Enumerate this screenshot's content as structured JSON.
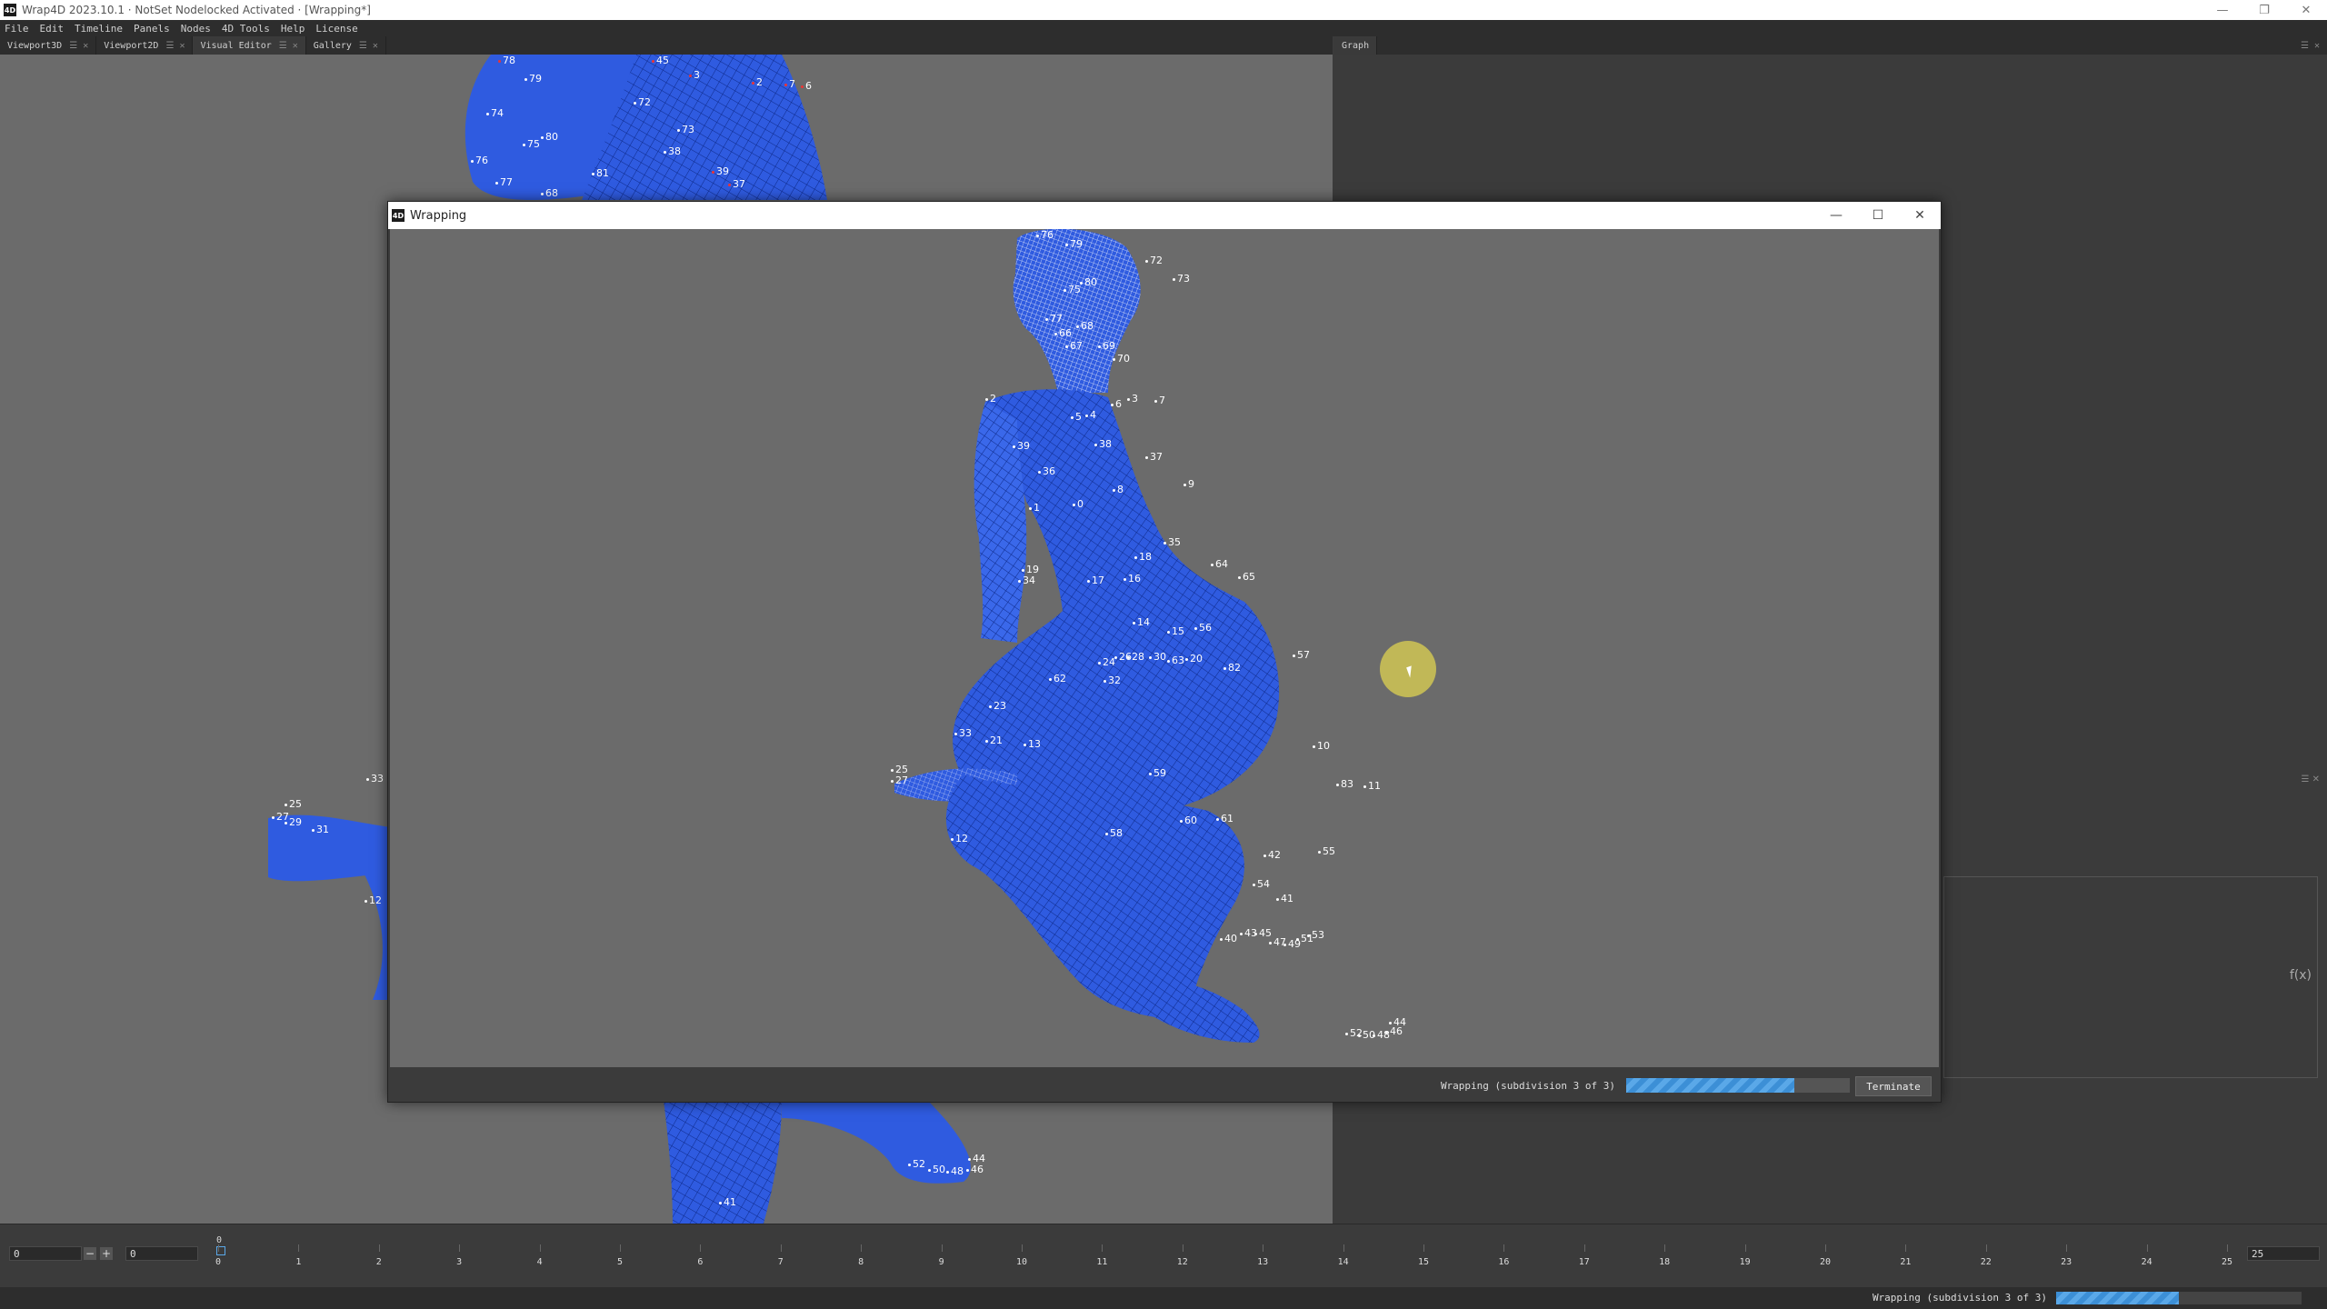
{
  "titlebar": {
    "icon": "4D",
    "title": "Wrap4D 2023.10.1 · NotSet Nodelocked Activated · [Wrapping*]",
    "controls": [
      "—",
      "❐",
      "✕"
    ]
  },
  "menu": [
    "File",
    "Edit",
    "Timeline",
    "Panels",
    "Nodes",
    "4D Tools",
    "Help",
    "License"
  ],
  "tabs_left": [
    {
      "label": "Viewport3D"
    },
    {
      "label": "Viewport2D"
    },
    {
      "label": "Visual Editor"
    },
    {
      "label": "Gallery"
    }
  ],
  "tabs_right": [
    {
      "label": "Graph"
    }
  ],
  "right_lower": {
    "fx": "f(x)"
  },
  "dialog": {
    "title": "Wrapping",
    "controls": [
      "—",
      "☐",
      "✕"
    ],
    "status_text": "Wrapping (subdivision 3 of 3)",
    "progress": 0.75,
    "terminate_label": "Terminate"
  },
  "timeline": {
    "start_value": "0",
    "current_value": "0",
    "end_value": "25",
    "top_marker": "0",
    "ticks": [
      "0",
      "1",
      "2",
      "3",
      "4",
      "5",
      "6",
      "7",
      "8",
      "9",
      "10",
      "11",
      "12",
      "13",
      "14",
      "15",
      "16",
      "17",
      "18",
      "19",
      "20",
      "21",
      "22",
      "23",
      "24",
      "25"
    ]
  },
  "status": {
    "text": "Wrapping (subdivision 3 of 3)",
    "progress": 0.5
  },
  "colors": {
    "mesh": "#2f5be0",
    "mesh_light": "#4d7bff",
    "wire": "#0e2a8a",
    "highlight": "#ded250"
  },
  "landmarks_dialog": [
    {
      "t": "76"
    },
    {
      "t": "79"
    },
    {
      "t": "72"
    },
    {
      "t": "73"
    },
    {
      "t": "75"
    },
    {
      "t": "80"
    },
    {
      "t": "77"
    },
    {
      "t": "66"
    },
    {
      "t": "68"
    },
    {
      "t": "67"
    },
    {
      "t": "69"
    },
    {
      "t": "70"
    },
    {
      "t": "2"
    },
    {
      "t": "5"
    },
    {
      "t": "4"
    },
    {
      "t": "6"
    },
    {
      "t": "3"
    },
    {
      "t": "7"
    },
    {
      "t": "39"
    },
    {
      "t": "38"
    },
    {
      "t": "37"
    },
    {
      "t": "36"
    },
    {
      "t": "9"
    },
    {
      "t": "8"
    },
    {
      "t": "1"
    },
    {
      "t": "0"
    },
    {
      "t": "35"
    },
    {
      "t": "18"
    },
    {
      "t": "19"
    },
    {
      "t": "34"
    },
    {
      "t": "17"
    },
    {
      "t": "16"
    },
    {
      "t": "64"
    },
    {
      "t": "65"
    },
    {
      "t": "14"
    },
    {
      "t": "15"
    },
    {
      "t": "56"
    },
    {
      "t": "24"
    },
    {
      "t": "26"
    },
    {
      "t": "28"
    },
    {
      "t": "30"
    },
    {
      "t": "63"
    },
    {
      "t": "20"
    },
    {
      "t": "57"
    },
    {
      "t": "62"
    },
    {
      "t": "32"
    },
    {
      "t": "82"
    },
    {
      "t": "23"
    },
    {
      "t": "33"
    },
    {
      "t": "21"
    },
    {
      "t": "13"
    },
    {
      "t": "10"
    },
    {
      "t": "25"
    },
    {
      "t": "27"
    },
    {
      "t": "59"
    },
    {
      "t": "83"
    },
    {
      "t": "11"
    },
    {
      "t": "60"
    },
    {
      "t": "61"
    },
    {
      "t": "58"
    },
    {
      "t": "12"
    },
    {
      "t": "42"
    },
    {
      "t": "55"
    },
    {
      "t": "54"
    },
    {
      "t": "41"
    },
    {
      "t": "40"
    },
    {
      "t": "43"
    },
    {
      "t": "45"
    },
    {
      "t": "47"
    },
    {
      "t": "49"
    },
    {
      "t": "51"
    },
    {
      "t": "53"
    },
    {
      "t": "44"
    },
    {
      "t": "52"
    },
    {
      "t": "50"
    },
    {
      "t": "48"
    },
    {
      "t": "46"
    }
  ],
  "landmarks_bg": [
    {
      "t": "78"
    },
    {
      "t": "45"
    },
    {
      "t": "79"
    },
    {
      "t": "3"
    },
    {
      "t": "2"
    },
    {
      "t": "7"
    },
    {
      "t": "6"
    },
    {
      "t": "74"
    },
    {
      "t": "72"
    },
    {
      "t": "73"
    },
    {
      "t": "80"
    },
    {
      "t": "75"
    },
    {
      "t": "38"
    },
    {
      "t": "76"
    },
    {
      "t": "81"
    },
    {
      "t": "39"
    },
    {
      "t": "77"
    },
    {
      "t": "37"
    },
    {
      "t": "68"
    },
    {
      "t": "33"
    },
    {
      "t": "25"
    },
    {
      "t": "27"
    },
    {
      "t": "29"
    },
    {
      "t": "31"
    },
    {
      "t": "12"
    },
    {
      "t": "52"
    },
    {
      "t": "50"
    },
    {
      "t": "48"
    },
    {
      "t": "44"
    },
    {
      "t": "46"
    },
    {
      "t": "41"
    }
  ]
}
